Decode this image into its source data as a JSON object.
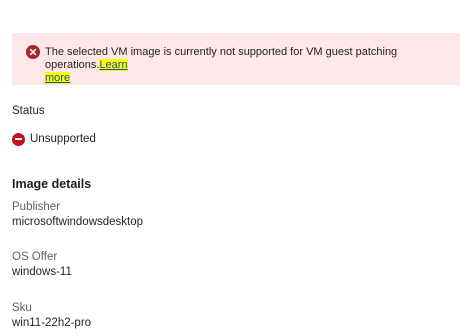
{
  "banner": {
    "message": "The selected VM image is currently not supported for VM guest patching operations.",
    "link_part1": "Learn",
    "link_part2": "more",
    "icon": "error-circle-icon"
  },
  "status": {
    "label": "Status",
    "value": "Unsupported",
    "icon": "blocked-icon"
  },
  "image_details": {
    "heading": "Image details",
    "publisher_label": "Publisher",
    "publisher_value": "microsoftwindowsdesktop",
    "os_offer_label": "OS Offer",
    "os_offer_value": "windows-11",
    "sku_label": "Sku",
    "sku_value": "win11-22h2-pro"
  },
  "colors": {
    "banner_bg": "#fde7e9",
    "error_red": "#a4262c",
    "link_highlight": "#ffff00",
    "link": "#0f4fa8"
  }
}
